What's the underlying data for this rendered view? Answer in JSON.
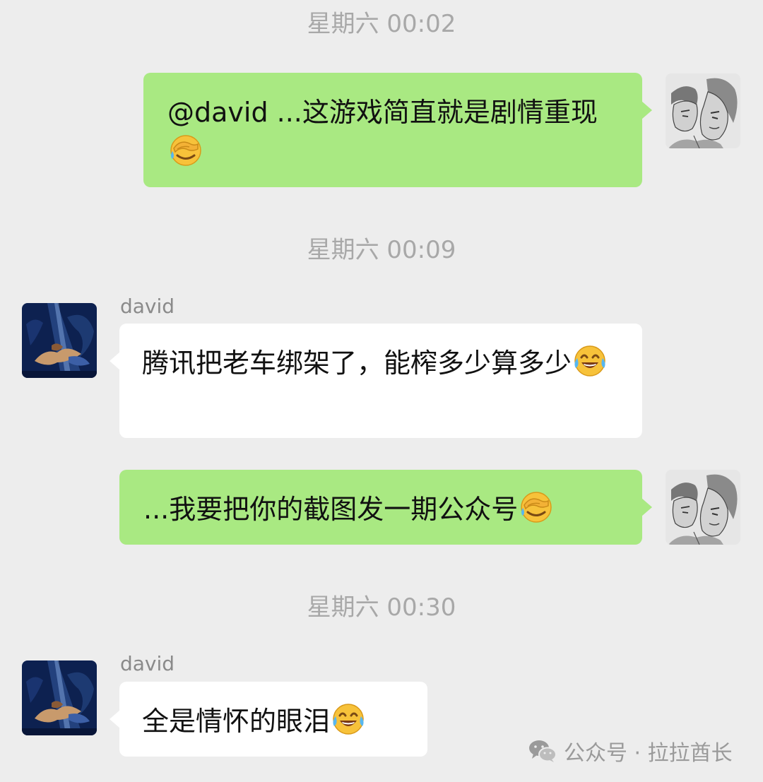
{
  "chat": {
    "timestamps": [
      "星期六 00:02",
      "星期六 00:09",
      "星期六 00:30"
    ],
    "messages": [
      {
        "direction": "outgoing",
        "text": "@david ...这游戏简直就是剧情重现",
        "emoji": "facepalm-emoji"
      },
      {
        "direction": "incoming",
        "sender": "david",
        "text": "腾讯把老车绑架了，能榨多少算多少",
        "emoji": "tears-of-joy-emoji"
      },
      {
        "direction": "outgoing",
        "text": "...我要把你的截图发一期公众号",
        "emoji": "facepalm-emoji"
      },
      {
        "direction": "incoming",
        "sender": "david",
        "text": "全是情怀的眼泪",
        "emoji": "tears-of-joy-emoji"
      }
    ]
  },
  "watermark": {
    "label": "公众号 · 拉拉酋长"
  },
  "colors": {
    "background": "#ededed",
    "outgoing_bubble": "#a9e982",
    "incoming_bubble": "#ffffff",
    "timestamp_text": "#a8a8a8"
  }
}
